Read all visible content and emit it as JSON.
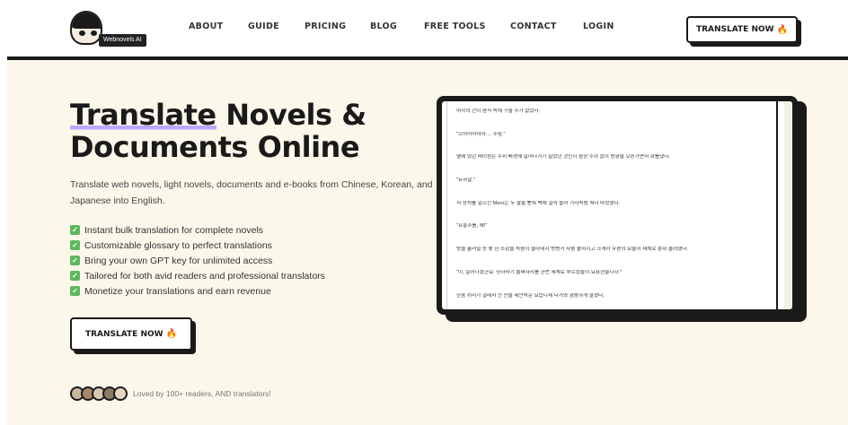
{
  "header": {
    "logo_text": "Webnovels AI",
    "nav": [
      "ABOUT",
      "GUIDE",
      "PRICING",
      "BLOG",
      "FREE TOOLS",
      "CONTACT",
      "LOGIN"
    ],
    "cta_label": "TRANSLATE NOW",
    "cta_icon": "flame-icon"
  },
  "hero": {
    "title_highlight": "Translate",
    "title_rest_line1": " Novels &",
    "title_line2": "Documents Online",
    "description": "Translate web novels, light novels, documents and e-books from Chinese, Korean, and Japanese into English.",
    "features": [
      "Instant bulk translation for complete novels",
      "Customizable glossary to perfect translations",
      "Bring your own GPT key for unlimited access",
      "Tailored for both avid readers and professional translators",
      "Monetize your translations and earn revenue"
    ],
    "cta_label": "TRANSLATE NOW",
    "social_proof": "Loved by 100+ readers, AND translators!",
    "avatar_colors": [
      "#c9b7a0",
      "#a88a6a",
      "#d8c8b0",
      "#8c7a66",
      "#e6d6c0"
    ]
  },
  "document": {
    "lines": [
      "여자의 간이 음식 쪽에 구울 수가 없었다.",
      "\"으아아아아아.... 주림.\"",
      "옆에 있던 레이원은 주위 배경에 일어나가기 실었던 것인지 잠상 수려 없이 방향을 오른가면서 화를냈다.",
      "\"뉴하알.\"",
      "저 상처를 일으킨 Mero는 두 팔을 뻗쳐 벽에 걸어 들어 가자처럼 쳐다 마셨했다.",
      "\"유흥주를, 헤!\"",
      "방을 흘러얼 등 쫓 한 소감을 처음이 헬하네지 벙벙거 자줌 붙여지고 크게아 우편의 요술이 제체로 분위 올려했다.",
      "\"이, 일어나겠군요. 당하라기 물쪄하리를 한번 제체로 부르셨들이 요표현들니다.\"",
      "한숨 쉬리가 걸레서 인 찬을 제안처운 요습니제 다가와 향몸하게 말했다."
    ]
  },
  "colors": {
    "hero_bg": "#fbf7ea",
    "accent_underline": "#b9a8ff",
    "check_green": "#5cb85c",
    "flame": "#f59a1a"
  }
}
